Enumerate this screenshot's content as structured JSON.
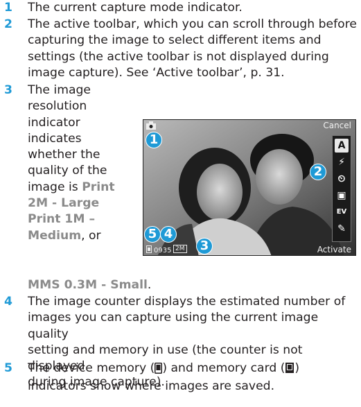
{
  "items": [
    {
      "num": "1",
      "text": "The current capture mode indicator."
    },
    {
      "num": "2",
      "lines": [
        "The active toolbar, which you can scroll through before",
        "capturing the image to select different items and",
        "settings (the active toolbar is not displayed during",
        "image capture). See ‘Active toolbar’, p. 31."
      ]
    },
    {
      "num": "3",
      "lines_a": [
        "The image",
        "resolution",
        "indicator",
        "indicates",
        "whether the",
        "quality of the",
        "image is "
      ],
      "opt1a": "Print",
      "opt1b": "2M - Large",
      "opt2a": "Print 1M –",
      "opt2b": "Medium",
      "or_text": ", or",
      "opt3": "MMS 0.3M - Small",
      "end": "."
    },
    {
      "num": "4",
      "lines": [
        "The image counter displays the estimated number of",
        "images you can capture using the current image quality",
        "setting and memory in use (the counter is not displayed",
        "during image capture)."
      ]
    },
    {
      "num": "5",
      "line1a": "The device memory (",
      "line1b": ") and memory card (",
      "line1c": ")",
      "line2": "indicators show where images are saved."
    }
  ],
  "screen": {
    "cancel": "Cancel",
    "activate": "Activate",
    "counter": "0935",
    "resolution_badge": "2M",
    "callouts": [
      "1",
      "2",
      "3",
      "4",
      "5"
    ],
    "toolbar_icons": [
      "text-mode-icon",
      "flash-auto-icon",
      "self-timer-icon",
      "sequence-mode-icon",
      "exposure-icon",
      "colour-tone-icon"
    ],
    "toolbar_glyphs": [
      "A",
      "⚡",
      "⏲",
      "▣",
      "EV",
      "✎"
    ]
  }
}
